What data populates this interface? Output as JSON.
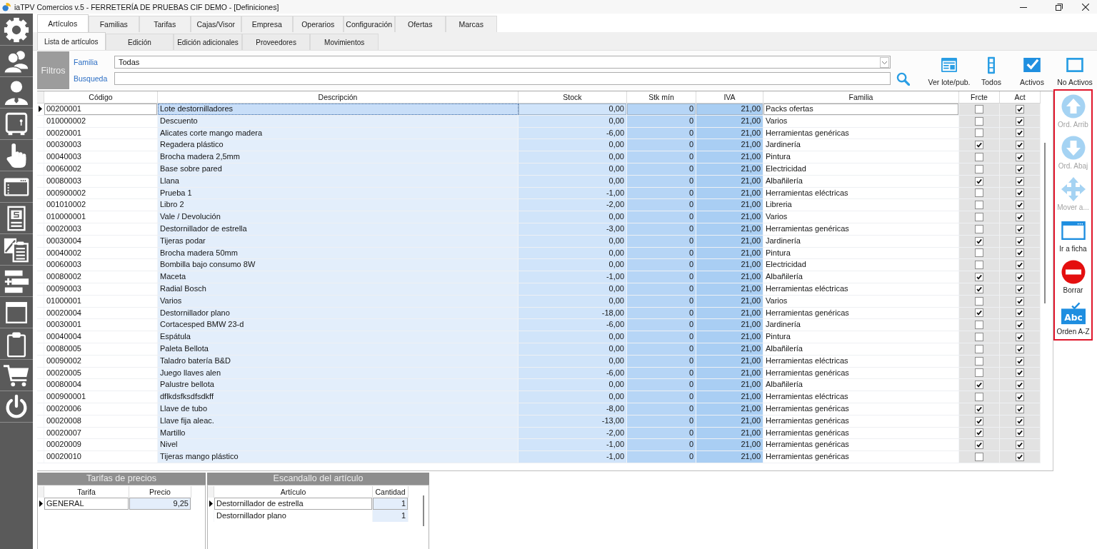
{
  "window": {
    "title": "iaTPV Comercios v.5 - FERRETERÍA DE PRUEBAS CIF DEMO - [Definiciones]"
  },
  "tabs": [
    {
      "label": "Artículos",
      "selected": true
    },
    {
      "label": "Familias",
      "selected": false
    },
    {
      "label": "Tarifas",
      "selected": false
    },
    {
      "label": "Cajas/Visor",
      "selected": false
    },
    {
      "label": "Empresa",
      "selected": false
    },
    {
      "label": "Operarios",
      "selected": false
    },
    {
      "label": "Configuración",
      "selected": false
    },
    {
      "label": "Ofertas",
      "selected": false
    },
    {
      "label": "Marcas",
      "selected": false
    }
  ],
  "subtabs": [
    {
      "label": "Lista de artículos",
      "selected": true
    },
    {
      "label": "Edición",
      "selected": false
    },
    {
      "label": "Edición adicionales",
      "selected": false
    },
    {
      "label": "Proveedores",
      "selected": false
    },
    {
      "label": "Movimientos",
      "selected": false
    }
  ],
  "filters": {
    "title": "Filtros",
    "fields": [
      {
        "kind": "dropdown",
        "label": "Familia",
        "value": "Todas"
      },
      {
        "kind": "text",
        "label": "Busqueda"
      }
    ]
  },
  "toolbar": [
    {
      "label": "Ver lote/pub."
    },
    {
      "label": "Todos"
    },
    {
      "label": "Activos"
    },
    {
      "label": "No Activos"
    }
  ],
  "table": {
    "columns": [
      "Código",
      "Descripción",
      "Stock",
      "Stk mín",
      "IVA",
      "Familia",
      "Frcte",
      "Act"
    ],
    "rows": [
      {
        "code": "00200001",
        "description": "Lote destornilladores",
        "stock": "0,00",
        "min_stock": "0",
        "vat": "21,00",
        "family": "Packs ofertas",
        "frcte": false,
        "act": true,
        "selected": true
      },
      {
        "code": "010000002",
        "description": "Descuento",
        "stock": "0,00",
        "min_stock": "0",
        "vat": "21,00",
        "family": "Varios",
        "frcte": false,
        "act": true,
        "selected": false
      },
      {
        "code": "00020001",
        "description": "Alicates corte mango madera",
        "stock": "-6,00",
        "min_stock": "0",
        "vat": "21,00",
        "family": "Herramientas genéricas",
        "frcte": false,
        "act": true,
        "selected": false
      },
      {
        "code": "00030003",
        "description": "Regadera plástico",
        "stock": "0,00",
        "min_stock": "0",
        "vat": "21,00",
        "family": "Jardinería",
        "frcte": true,
        "act": true,
        "selected": false
      },
      {
        "code": "00040003",
        "description": "Brocha madera 2,5mm",
        "stock": "0,00",
        "min_stock": "0",
        "vat": "21,00",
        "family": "Pintura",
        "frcte": false,
        "act": true,
        "selected": false
      },
      {
        "code": "00060002",
        "description": "Base sobre pared",
        "stock": "0,00",
        "min_stock": "0",
        "vat": "21,00",
        "family": "Electricidad",
        "frcte": false,
        "act": true,
        "selected": false
      },
      {
        "code": "00080003",
        "description": "Llana",
        "stock": "0,00",
        "min_stock": "0",
        "vat": "21,00",
        "family": "Albañilería",
        "frcte": true,
        "act": true,
        "selected": false
      },
      {
        "code": "000900002",
        "description": "Prueba 1",
        "stock": "-1,00",
        "min_stock": "0",
        "vat": "21,00",
        "family": "Herramientas eléctricas",
        "frcte": false,
        "act": true,
        "selected": false
      },
      {
        "code": "001010002",
        "description": "Libro 2",
        "stock": "-2,00",
        "min_stock": "0",
        "vat": "21,00",
        "family": "Libreria",
        "frcte": false,
        "act": true,
        "selected": false
      },
      {
        "code": "010000001",
        "description": "Vale / Devolución",
        "stock": "0,00",
        "min_stock": "0",
        "vat": "21,00",
        "family": "Varios",
        "frcte": false,
        "act": true,
        "selected": false
      },
      {
        "code": "00020003",
        "description": "Destornillador de estrella",
        "stock": "-3,00",
        "min_stock": "0",
        "vat": "21,00",
        "family": "Herramientas genéricas",
        "frcte": false,
        "act": true,
        "selected": false
      },
      {
        "code": "00030004",
        "description": "Tijeras podar",
        "stock": "0,00",
        "min_stock": "0",
        "vat": "21,00",
        "family": "Jardinería",
        "frcte": true,
        "act": true,
        "selected": false
      },
      {
        "code": "00040002",
        "description": "Brocha madera 50mm",
        "stock": "0,00",
        "min_stock": "0",
        "vat": "21,00",
        "family": "Pintura",
        "frcte": false,
        "act": true,
        "selected": false
      },
      {
        "code": "00060003",
        "description": "Bombilla bajo consumo 8W",
        "stock": "0,00",
        "min_stock": "0",
        "vat": "21,00",
        "family": "Electricidad",
        "frcte": false,
        "act": true,
        "selected": false
      },
      {
        "code": "00080002",
        "description": "Maceta",
        "stock": "-1,00",
        "min_stock": "0",
        "vat": "21,00",
        "family": "Albañilería",
        "frcte": true,
        "act": true,
        "selected": false
      },
      {
        "code": "00090003",
        "description": "Radial Bosch",
        "stock": "0,00",
        "min_stock": "0",
        "vat": "21,00",
        "family": "Herramientas eléctricas",
        "frcte": true,
        "act": true,
        "selected": false
      },
      {
        "code": "01000001",
        "description": "Varios",
        "stock": "0,00",
        "min_stock": "0",
        "vat": "21,00",
        "family": "Varios",
        "frcte": false,
        "act": true,
        "selected": false
      },
      {
        "code": "00020004",
        "description": "Destornillador plano",
        "stock": "-18,00",
        "min_stock": "0",
        "vat": "21,00",
        "family": "Herramientas genéricas",
        "frcte": true,
        "act": true,
        "selected": false
      },
      {
        "code": "00030001",
        "description": "Cortacesped BMW 23-d",
        "stock": "-6,00",
        "min_stock": "0",
        "vat": "21,00",
        "family": "Jardinería",
        "frcte": false,
        "act": true,
        "selected": false
      },
      {
        "code": "00040004",
        "description": "Espátula",
        "stock": "0,00",
        "min_stock": "0",
        "vat": "21,00",
        "family": "Pintura",
        "frcte": false,
        "act": true,
        "selected": false
      },
      {
        "code": "00080005",
        "description": "Paleta Bellota",
        "stock": "0,00",
        "min_stock": "0",
        "vat": "21,00",
        "family": "Albañilería",
        "frcte": false,
        "act": true,
        "selected": false
      },
      {
        "code": "00090002",
        "description": "Taladro batería B&D",
        "stock": "0,00",
        "min_stock": "0",
        "vat": "21,00",
        "family": "Herramientas eléctricas",
        "frcte": false,
        "act": true,
        "selected": false
      },
      {
        "code": "00020005",
        "description": "Juego llaves alen",
        "stock": "-6,00",
        "min_stock": "0",
        "vat": "21,00",
        "family": "Herramientas genéricas",
        "frcte": false,
        "act": true,
        "selected": false
      },
      {
        "code": "00080004",
        "description": "Palustre bellota",
        "stock": "0,00",
        "min_stock": "0",
        "vat": "21,00",
        "family": "Albañilería",
        "frcte": true,
        "act": true,
        "selected": false
      },
      {
        "code": "000900001",
        "description": "dflkdsfksdfsdkff",
        "stock": "0,00",
        "min_stock": "0",
        "vat": "21,00",
        "family": "Herramientas eléctricas",
        "frcte": false,
        "act": true,
        "selected": false
      },
      {
        "code": "00020006",
        "description": "Llave de tubo",
        "stock": "-8,00",
        "min_stock": "0",
        "vat": "21,00",
        "family": "Herramientas genéricas",
        "frcte": true,
        "act": true,
        "selected": false
      },
      {
        "code": "00020008",
        "description": "Llave fija aleac.",
        "stock": "-13,00",
        "min_stock": "0",
        "vat": "21,00",
        "family": "Herramientas genéricas",
        "frcte": true,
        "act": true,
        "selected": false
      },
      {
        "code": "00020007",
        "description": "Martillo",
        "stock": "-2,00",
        "min_stock": "0",
        "vat": "21,00",
        "family": "Herramientas genéricas",
        "frcte": true,
        "act": true,
        "selected": false
      },
      {
        "code": "00020009",
        "description": "Nivel",
        "stock": "-1,00",
        "min_stock": "0",
        "vat": "21,00",
        "family": "Herramientas genéricas",
        "frcte": true,
        "act": true,
        "selected": false
      },
      {
        "code": "00020010",
        "description": "Tijeras mango plástico",
        "stock": "-1,00",
        "min_stock": "0",
        "vat": "21,00",
        "family": "Herramientas genéricas",
        "frcte": false,
        "act": true,
        "selected": false
      }
    ]
  },
  "side_panel": {
    "highlighted": true,
    "buttons": [
      {
        "label": "Ord. Arrib",
        "disabled": true
      },
      {
        "label": "Ord. Abaj",
        "disabled": true
      },
      {
        "label": "Mover a...",
        "disabled": true
      },
      {
        "label": "Ir a ficha",
        "disabled": false
      },
      {
        "label": "Borrar",
        "disabled": false
      },
      {
        "label": "Orden A-Z",
        "disabled": false,
        "icon_text": "Abc"
      }
    ]
  },
  "price_rates": {
    "title": "Tarifas de precios",
    "columns": [
      "Tarifa",
      "Precio"
    ],
    "rows": [
      {
        "rate": "GENERAL",
        "price": "9,25",
        "selected": true
      }
    ]
  },
  "breakdown": {
    "title": "Escandallo del artículo",
    "columns": [
      "Artículo",
      "Cantidad"
    ],
    "rows": [
      {
        "article": "Destornillador de estrella",
        "quantity": "1",
        "selected": true
      },
      {
        "article": "Destornillador plano",
        "quantity": "1",
        "selected": false
      }
    ]
  }
}
